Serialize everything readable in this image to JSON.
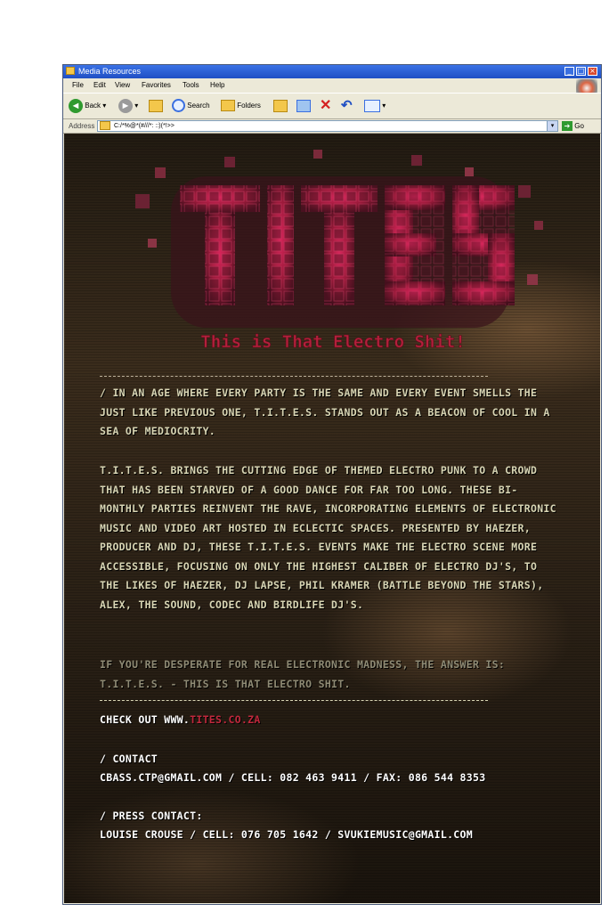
{
  "window": {
    "title": "Media Resources"
  },
  "menu": {
    "items": [
      "File",
      "Edit",
      "View",
      "Favorites",
      "Tools",
      "Help"
    ]
  },
  "toolbar": {
    "back_label": "Back",
    "search_label": "Search",
    "folders_label": "Folders"
  },
  "address": {
    "label": "Address",
    "value": "C:/*%@*(#///*: ::)(*!>>",
    "go_label": "Go"
  },
  "logo": {
    "text": "TITES",
    "tagline": "This is That Electro Shit!"
  },
  "body": {
    "p1": "/ In an age where every party is the same and every event smells the just like previous one, T.I.T.E.S. stands out as a beacon of cool in a sea of mediocrity.",
    "p2": "T.I.T.E.S. brings the cutting edge of themed electro punk to a crowd that has been starved of a good dance for far too long. These bi-monthly parties reinvent the rave, incorporating elements of electronic music and video art hosted in eclectic spaces. Presented by Haezer, producer and DJ, these T.I.T.E.S. events make the electro scene more accessible, focusing on only the highest caliber of electro DJ's, to the likes of Haezer, DJ Lapse, Phil Kramer (Battle Beyond the Stars), Alex, The Sound, Codec and Birdlife DJ's.",
    "p3": "If you're desperate for real electronic madness, the answer is: T.I.T.E.S. -  This is That Electro Shit.",
    "checkout_prefix": "Check out www.",
    "checkout_link": "tites.co.za",
    "contact_heading": "/ Contact",
    "contact_line": "cbass.ctp@gmail.com / Cell: 082 463 9411 / Fax: 086 544 8353",
    "press_heading": "/ Press Contact:",
    "press_line": "Louise Crouse / Cell: 076 705 1642 / svukiemusic@gmail.com"
  },
  "colors": {
    "text": "#d8d5b4",
    "accent_red": "#c0283c",
    "titlebar_blue": "#1f4fc4"
  }
}
